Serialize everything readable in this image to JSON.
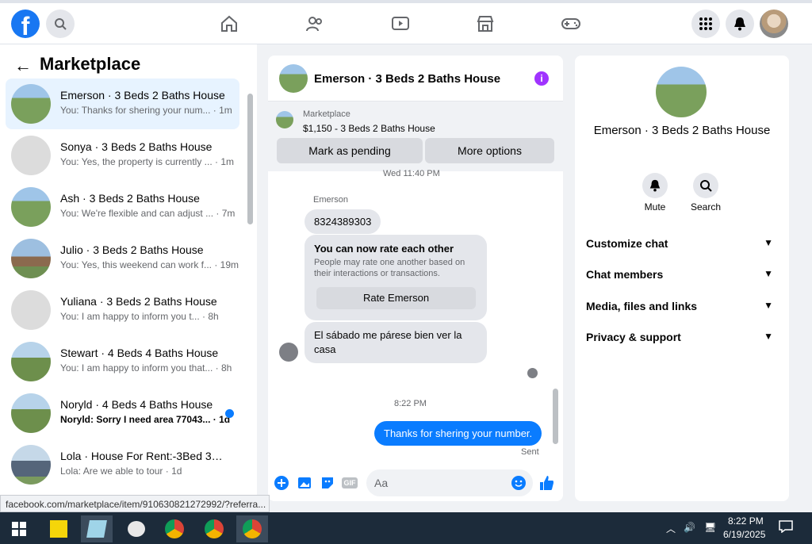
{
  "topbar": {
    "logo": "f"
  },
  "left": {
    "title": "Marketplace",
    "conversations": [
      {
        "name": "Emerson · 3 Beds 2 Baths House",
        "preview": "You: Thanks for shering your num... · 1m",
        "active": true,
        "thumb": "house"
      },
      {
        "name": "Sonya · 3 Beds 2 Baths House",
        "preview": "You: Yes, the property is currently ... · 1m",
        "thumb": "house2"
      },
      {
        "name": "Ash · 3 Beds 2 Baths House",
        "preview": "You: We're flexible and can adjust ... · 7m",
        "thumb": "house"
      },
      {
        "name": "Julio · 3 Beds 2 Baths House",
        "preview": "You: Yes, this weekend can work f... · 19m",
        "thumb": "house4"
      },
      {
        "name": "Yuliana · 3 Beds 2 Baths House",
        "preview": "You: I am happy to inform you t... · 8h",
        "thumb": "house2"
      },
      {
        "name": "Stewart · 4 Beds 4 Baths House",
        "preview": "You: I am happy to inform you that... · 8h",
        "thumb": "house3"
      },
      {
        "name": "Noryld · 4 Beds 4 Baths House",
        "preview": "Noryld: Sorry I need area 77043... · 1d",
        "unread": true,
        "thumb": "house3"
      },
      {
        "name": "Lola · House For Rent:-3Bed 3Ba...",
        "preview": "Lola: Are we able to tour · 1d",
        "thumb": "house5"
      }
    ]
  },
  "chat": {
    "title": "Emerson · 3 Beds 2 Baths House",
    "marketplace_label": "Marketplace",
    "listing": "$1,150 - 3 Beds 2 Baths House",
    "mark_pending": "Mark as pending",
    "more_options": "More options",
    "timestamp1": "Wed 11:40 PM",
    "sender": "Emerson",
    "msg_number": "8324389303",
    "rate_title": "You can now rate each other",
    "rate_desc": "People may rate one another based on their interactions or transactions.",
    "rate_button": "Rate Emerson",
    "msg_spanish": "El sábado me párese bien ver la casa",
    "timestamp2": "8:22 PM",
    "my_msg": "Thanks for shering your number.",
    "sent": "Sent",
    "input_placeholder": "Aa",
    "gif": "GIF"
  },
  "right": {
    "title": "Emerson · 3 Beds 2 Baths House",
    "mute": "Mute",
    "search": "Search",
    "sections": [
      "Customize chat",
      "Chat members",
      "Media, files and links",
      "Privacy & support"
    ]
  },
  "status_url": "facebook.com/marketplace/item/910630821272992/?referra...",
  "taskbar": {
    "time": "8:22 PM",
    "date": "6/19/2025"
  }
}
